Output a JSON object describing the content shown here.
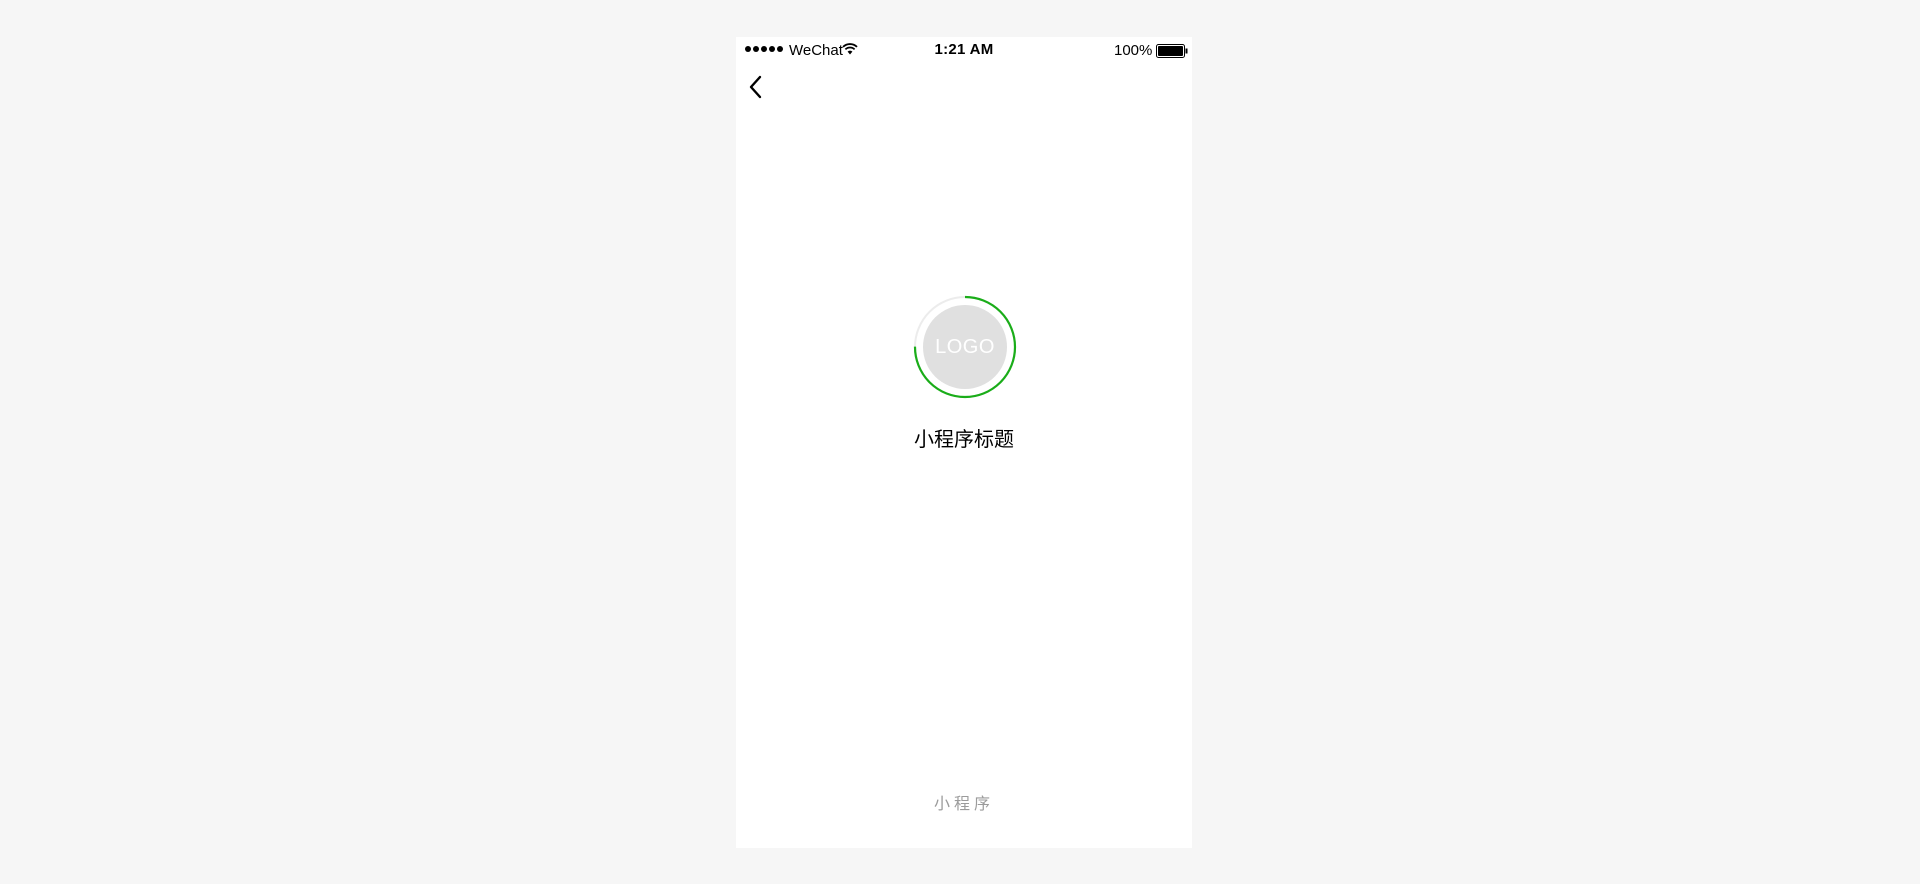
{
  "status_bar": {
    "carrier": "WeChat",
    "time": "1:21 AM",
    "battery_percent": "100%",
    "signal_icon": "signal-dots-icon",
    "wifi_icon": "wifi-icon",
    "battery_icon": "battery-icon"
  },
  "nav": {
    "back_icon": "chevron-left-icon"
  },
  "loading": {
    "logo_text": "LOGO",
    "progress": 0.75,
    "progress_color": "#1aad19",
    "track_color": "#ececec"
  },
  "app": {
    "title": "小程序标题"
  },
  "footer": {
    "label": "小程序"
  }
}
